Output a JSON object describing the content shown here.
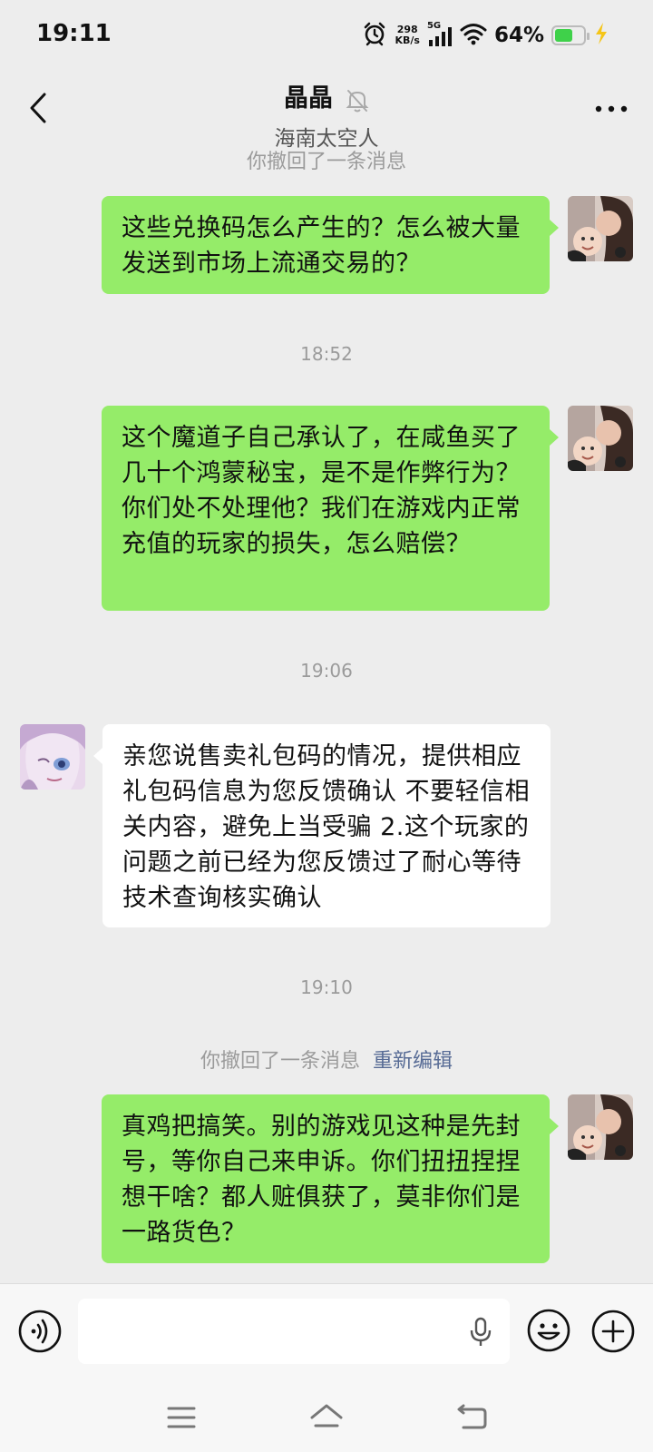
{
  "status_bar": {
    "time": "19:11",
    "net_speed_value": "298",
    "net_speed_unit": "KB/s",
    "network_type": "5G",
    "battery_percent": "64%",
    "battery_level": 0.64,
    "icons": [
      "alarm-icon",
      "signal-icon",
      "wifi-icon",
      "battery-icon",
      "charging-icon"
    ]
  },
  "header": {
    "title": "晶晶",
    "subtitle": "海南太空人",
    "icons": [
      "back-arrow-icon",
      "mute-bell-icon",
      "more-dots-icon"
    ]
  },
  "messages": [
    {
      "type": "system",
      "text": "你撤回了一条消息"
    },
    {
      "type": "message",
      "sender": "me",
      "text": "这些兑换码怎么产生的？怎么被大量发送到市场上流通交易的？"
    },
    {
      "type": "time",
      "text": "18:52"
    },
    {
      "type": "message",
      "sender": "me",
      "text": "这个魔道子自己承认了，在咸鱼买了几十个鸿蒙秘宝，是不是作弊行为？你们处不处理他？我们在游戏内正常充值的玩家的损失，怎么赔偿？"
    },
    {
      "type": "time",
      "text": "19:06"
    },
    {
      "type": "message",
      "sender": "other",
      "text": "  亲您说售卖礼包码的情况，提供相应礼包码信息为您反馈确认 不要轻信相关内容，避免上当受骗 2.这个玩家的问题之前已经为您反馈过了耐心等待技术查询核实确认"
    },
    {
      "type": "time",
      "text": "19:10"
    },
    {
      "type": "system",
      "text": "你撤回了一条消息",
      "link": "重新编辑"
    },
    {
      "type": "message",
      "sender": "me",
      "text": "真鸡把搞笑。别的游戏见这种是先封号，等你自己来申诉。你们扭扭捏捏想干啥？都人赃俱获了，莫非你们是一路货色？"
    }
  ],
  "input_bar": {
    "placeholder": "",
    "icons": [
      "voice-icon",
      "mic-icon",
      "emoji-icon",
      "plus-icon"
    ]
  },
  "nav_bar": {
    "icons": [
      "menu-icon",
      "home-icon",
      "back-icon"
    ]
  },
  "colors": {
    "background": "#ededed",
    "my_bubble": "#95ec69",
    "other_bubble": "#ffffff",
    "link": "#576b95",
    "battery_fill": "#3fd14a"
  }
}
